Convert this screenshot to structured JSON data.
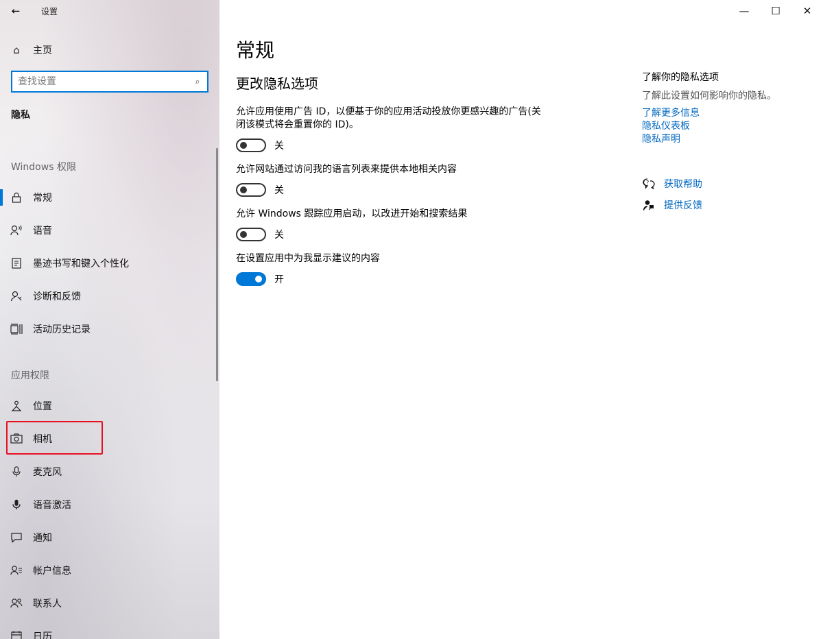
{
  "window": {
    "app_title": "设置",
    "controls": {
      "minimize": "—",
      "maximize": "☐",
      "close": "✕"
    }
  },
  "sidebar": {
    "home_label": "主页",
    "search_placeholder": "查找设置",
    "category": "隐私",
    "groups": [
      {
        "heading": "Windows 权限",
        "items": [
          {
            "label": "常规",
            "icon": "lock-icon",
            "active": true
          },
          {
            "label": "语音",
            "icon": "speech-icon"
          },
          {
            "label": "墨迹书写和键入个性化",
            "icon": "inking-icon"
          },
          {
            "label": "诊断和反馈",
            "icon": "feedback-person-icon"
          },
          {
            "label": "活动历史记录",
            "icon": "timeline-icon"
          }
        ]
      },
      {
        "heading": "应用权限",
        "items": [
          {
            "label": "位置",
            "icon": "location-icon"
          },
          {
            "label": "相机",
            "icon": "camera-icon"
          },
          {
            "label": "麦克风",
            "icon": "microphone-icon"
          },
          {
            "label": "语音激活",
            "icon": "voice-activation-icon"
          },
          {
            "label": "通知",
            "icon": "notification-icon"
          },
          {
            "label": "帐户信息",
            "icon": "account-info-icon"
          },
          {
            "label": "联系人",
            "icon": "contacts-icon"
          },
          {
            "label": "日历",
            "icon": "calendar-icon"
          }
        ]
      }
    ]
  },
  "main": {
    "page_title": "常规",
    "section_title": "更改隐私选项",
    "settings": [
      {
        "desc": "允许应用使用广告 ID，以便基于你的应用活动投放你更感兴趣的广告(关闭该模式将会重置你的 ID)。",
        "state": "关",
        "on": false
      },
      {
        "desc": "允许网站通过访问我的语言列表来提供本地相关内容",
        "state": "关",
        "on": false
      },
      {
        "desc": "允许 Windows 跟踪应用启动，以改进开始和搜索结果",
        "state": "关",
        "on": false
      },
      {
        "desc": "在设置应用中为我显示建议的内容",
        "state": "开",
        "on": true
      }
    ]
  },
  "aside": {
    "title": "了解你的隐私选项",
    "desc": "了解此设置如何影响你的隐私。",
    "links": [
      "了解更多信息",
      "隐私仪表板",
      "隐私声明"
    ],
    "help": [
      {
        "label": "获取帮助",
        "icon": "help-chat-icon"
      },
      {
        "label": "提供反馈",
        "icon": "give-feedback-icon"
      }
    ]
  },
  "colors": {
    "accent": "#0078d7",
    "link": "#0067c0",
    "highlight": "#e81123"
  }
}
